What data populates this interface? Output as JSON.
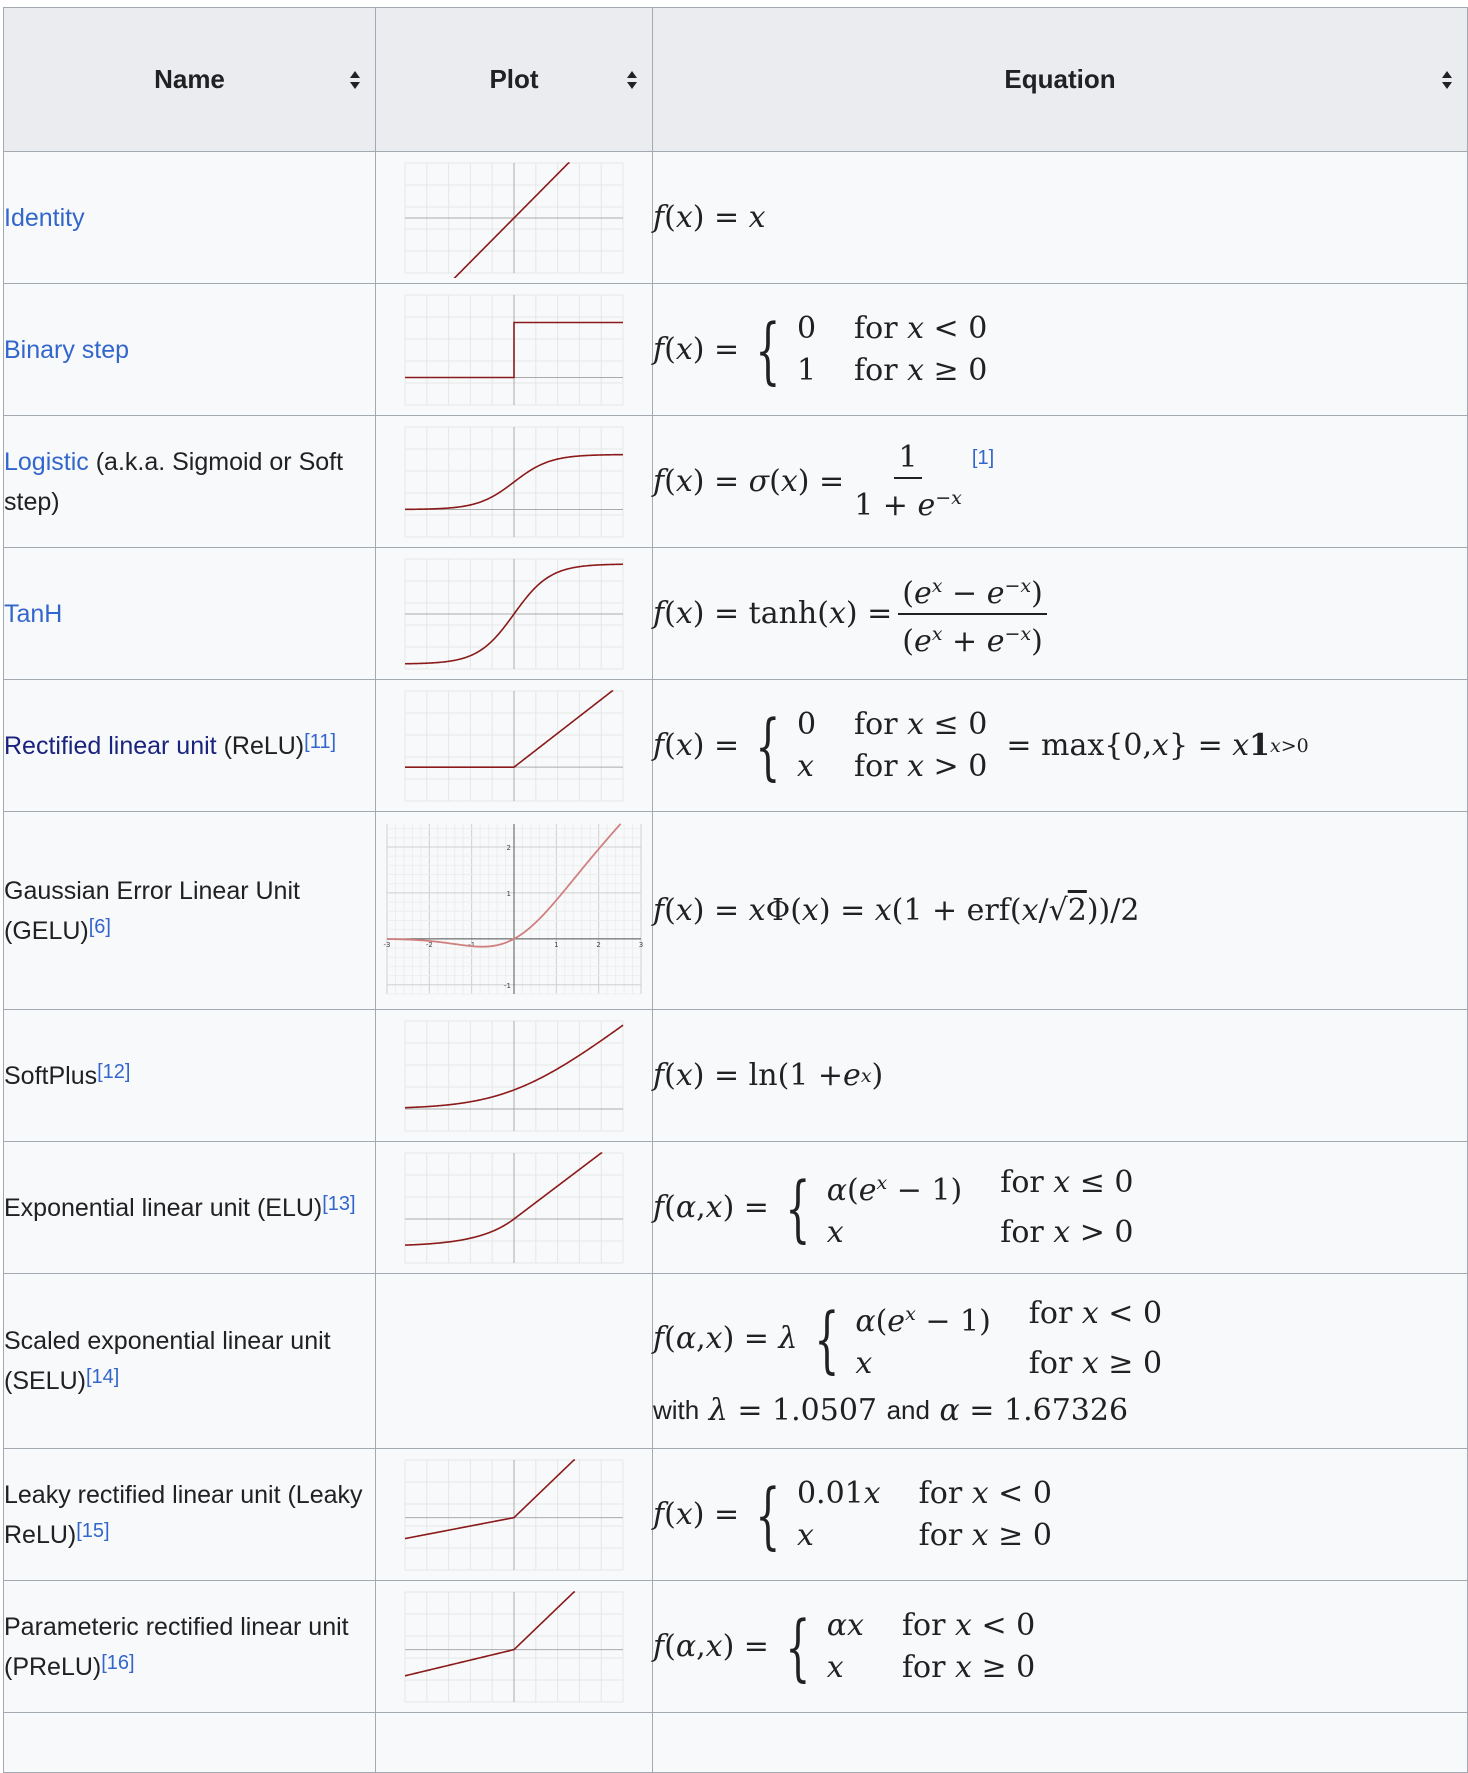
{
  "table": {
    "headers": [
      "Name",
      "Plot",
      "Equation"
    ],
    "rows": [
      {
        "name": "Identity",
        "link": true
      },
      {
        "name": "Binary step",
        "link": true
      },
      {
        "name": "Logistic",
        "suffix": " (a.k.a. Sigmoid or Soft step)",
        "link": true
      },
      {
        "name": "TanH",
        "link": true
      },
      {
        "name": "Rectified linear unit",
        "suffix": " (ReLU)",
        "ref": "[11]",
        "link": true
      },
      {
        "name": "Gaussian Error Linear Unit (GELU)",
        "ref": "[6]",
        "link": false
      },
      {
        "name": "SoftPlus",
        "ref": "[12]",
        "link": false
      },
      {
        "name": "Exponential linear unit (ELU)",
        "ref": "[13]",
        "link": false
      },
      {
        "name": "Scaled exponential linear unit (SELU)",
        "ref": "[14]",
        "link": false
      },
      {
        "name": "Leaky rectified linear unit (Leaky ReLU)",
        "ref": "[15]",
        "link": false
      },
      {
        "name": "Parameteric rectified linear unit (PReLU)",
        "ref": "[16]",
        "link": false
      }
    ],
    "equation_refs": {
      "logistic": "[1]"
    },
    "selu_constants": {
      "with": "with",
      "lambda_value": "1.0507",
      "and": "and",
      "alpha_value": "1.67326"
    },
    "leaky_slope": "0.01"
  },
  "colors": {
    "link": "#3366cc",
    "visited_link": "#1a237e",
    "curve": "#8b1a1a",
    "gelu_curve": "#d08080",
    "border": "#a2a9b1",
    "header_bg": "#eaecf0",
    "cell_bg": "#f8f9fa"
  }
}
